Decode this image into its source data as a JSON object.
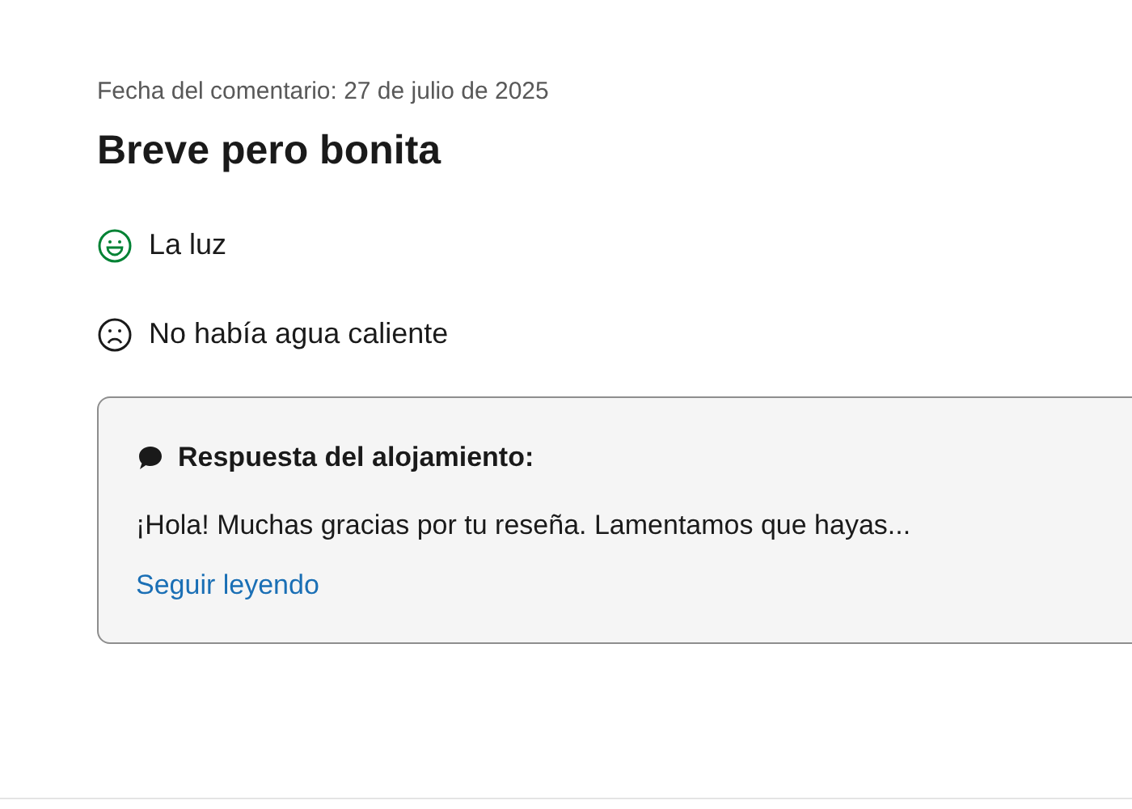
{
  "review": {
    "date": "Fecha del comentario: 27 de julio de 2025",
    "title": "Breve pero bonita",
    "points": [
      {
        "kind": "positive",
        "text": "La luz"
      },
      {
        "kind": "negative",
        "text": "No había agua caliente"
      }
    ],
    "response": {
      "heading": "Respuesta del alojamiento:",
      "text": "¡Hola! Muchas gracias por tu reseña. Lamentamos que hayas...",
      "link": "Seguir leyendo"
    }
  }
}
